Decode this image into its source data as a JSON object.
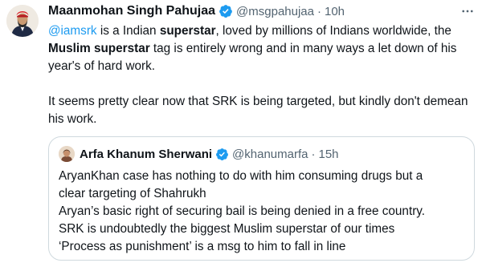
{
  "tweet": {
    "author_name": "Maanmohan Singh Pahujaa",
    "handle": "@msgpahujaa",
    "separator": "·",
    "time": "10h",
    "verified_color": "#1d9bf0",
    "paragraph1": {
      "mention": "@iamsrk",
      "text1": " is a Indian ",
      "bold1": "superstar",
      "text2": ", loved by millions of Indians worldwide, the ",
      "bold2": "Muslim superstar",
      "text3": " tag is entirely wrong and in many ways a let down of his year's of hard work."
    },
    "paragraph2": "It seems pretty clear now that SRK is being targeted, but kindly don't demean his work."
  },
  "quoted_tweet": {
    "author_name": "Arfa Khanum Sherwani",
    "handle": "@khanumarfa",
    "separator": "·",
    "time": "15h",
    "lines": [
      "AryanKhan case has nothing to do with him consuming drugs but a",
      "clear targeting of Shahrukh",
      "Aryan’s basic right of securing bail is being denied in a free country.",
      "SRK is undoubtedly the biggest Muslim superstar of our times",
      "‘Process as punishment’ is a msg to him to fall in line"
    ]
  },
  "icons": {
    "verified": "verified-badge-icon",
    "more": "more-options-icon"
  }
}
